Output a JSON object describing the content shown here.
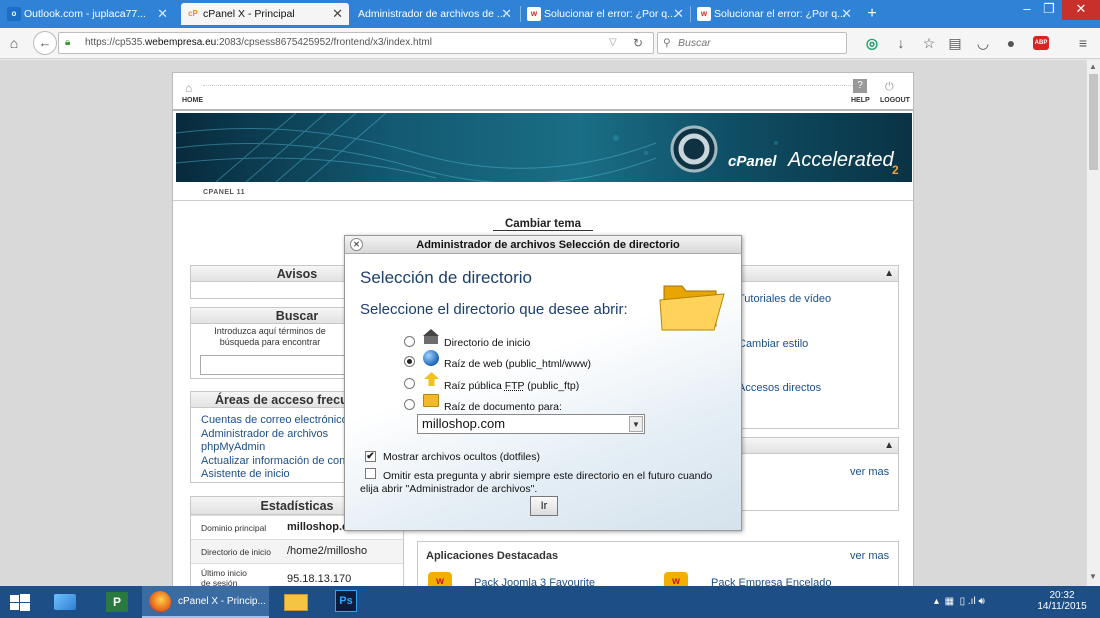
{
  "browser": {
    "tabs": [
      {
        "label": "Outlook.com - juplaca77...",
        "favicon": "outlook-icon",
        "color": "#1a6fc5",
        "active": false
      },
      {
        "label": "cPanel X - Principal",
        "favicon": "cpanel-icon",
        "color": "#f18b1a",
        "active": true
      },
      {
        "label": "Administrador de archivos de ...",
        "favicon": "",
        "color": "",
        "active": false
      },
      {
        "label": "Solucionar el error: ¿Por q...",
        "favicon": "webempresa-icon",
        "color": "#d12a2a",
        "active": false
      },
      {
        "label": "Solucionar el error: ¿Por q...",
        "favicon": "webempresa-icon",
        "color": "#d12a2a",
        "active": false
      }
    ],
    "favicon_text": {
      "outlook": "o",
      "cpanel": "cP",
      "webempresa": "w"
    },
    "url_prefix": "https://cp535.",
    "url_domain": "webempresa.eu",
    "url_suffix": ":2083/cpsess8675425952/frontend/x3/index.html",
    "search_placeholder": "Buscar",
    "new_tab": "+"
  },
  "cpanel": {
    "home_label": "HOME",
    "help_label": "HELP",
    "logout_label": "LOGOUT",
    "banner_brand": "cPanel",
    "banner_accel": "Accelerated",
    "banner_version": "2",
    "version_strip": "CPANEL 11",
    "change_theme": "Cambiar tema",
    "panels": {
      "avisos": "Avisos",
      "buscar": "Buscar",
      "buscar_text": "Introduzca aquí términos de búsqueda para encontrar rápidamente las funciones",
      "areas": "Áreas de acceso frecuente",
      "areas_links": [
        "Cuentas de correo electrónico",
        "Administrador de archivos",
        "phpMyAdmin",
        "Actualizar información de contacto",
        "Asistente de inicio"
      ],
      "estadisticas": "Estadísticas",
      "stats": [
        {
          "key": "Dominio principal",
          "value": "milloshop.com"
        },
        {
          "key": "Directorio de inicio",
          "value": "/home2/millosho"
        },
        {
          "key": "Último inicio de sesión desde",
          "value": "95.18.13.170"
        }
      ]
    },
    "right_links": [
      "Tutoriales de vídeo",
      "Cambiar estilo",
      "Accesos directos"
    ],
    "ver_mas": "ver mas",
    "apps_title": "Aplicaciones Destacadas",
    "apps": [
      "Pack Joomla 3 Favourite",
      "Pack Empresa Encelado"
    ]
  },
  "dialog": {
    "title": "Administrador de archivos Selección de directorio",
    "heading": "Selección de directorio",
    "subheading": "Seleccione el directorio que desee abrir:",
    "options": [
      {
        "label": "Directorio de inicio",
        "icon": "home-folder-icon",
        "selected": false
      },
      {
        "label": "Raíz de web (public_html/www)",
        "icon": "globe-icon",
        "selected": true
      },
      {
        "label_pre": "Raíz pública ",
        "label_abbr": "FTP",
        "label_post": " (public_ftp)",
        "icon": "ftp-icon",
        "selected": false
      },
      {
        "label": "Raíz de documento para:",
        "icon": "folder-icon",
        "selected": false
      }
    ],
    "domain_select_value": "milloshop.com",
    "show_hidden": {
      "label": "Mostrar archivos ocultos (dotfiles)",
      "checked": true
    },
    "skip_question": {
      "label_line1": "Omitir esta pregunta y abrir siempre este directorio en el futuro cuando",
      "label_line2": "elija abrir \"Administrador de archivos\".",
      "checked": false
    },
    "go_button": "Ir",
    "check_mark": "✔"
  },
  "taskbar": {
    "firefox_label": "cPanel X - Princip...",
    "ps_label": "Ps",
    "time": "20:32",
    "date": "14/11/2015"
  },
  "colors": {
    "tabbar": "#2f82d6",
    "link": "#1c4f8a",
    "taskbar": "#1d4f86"
  }
}
